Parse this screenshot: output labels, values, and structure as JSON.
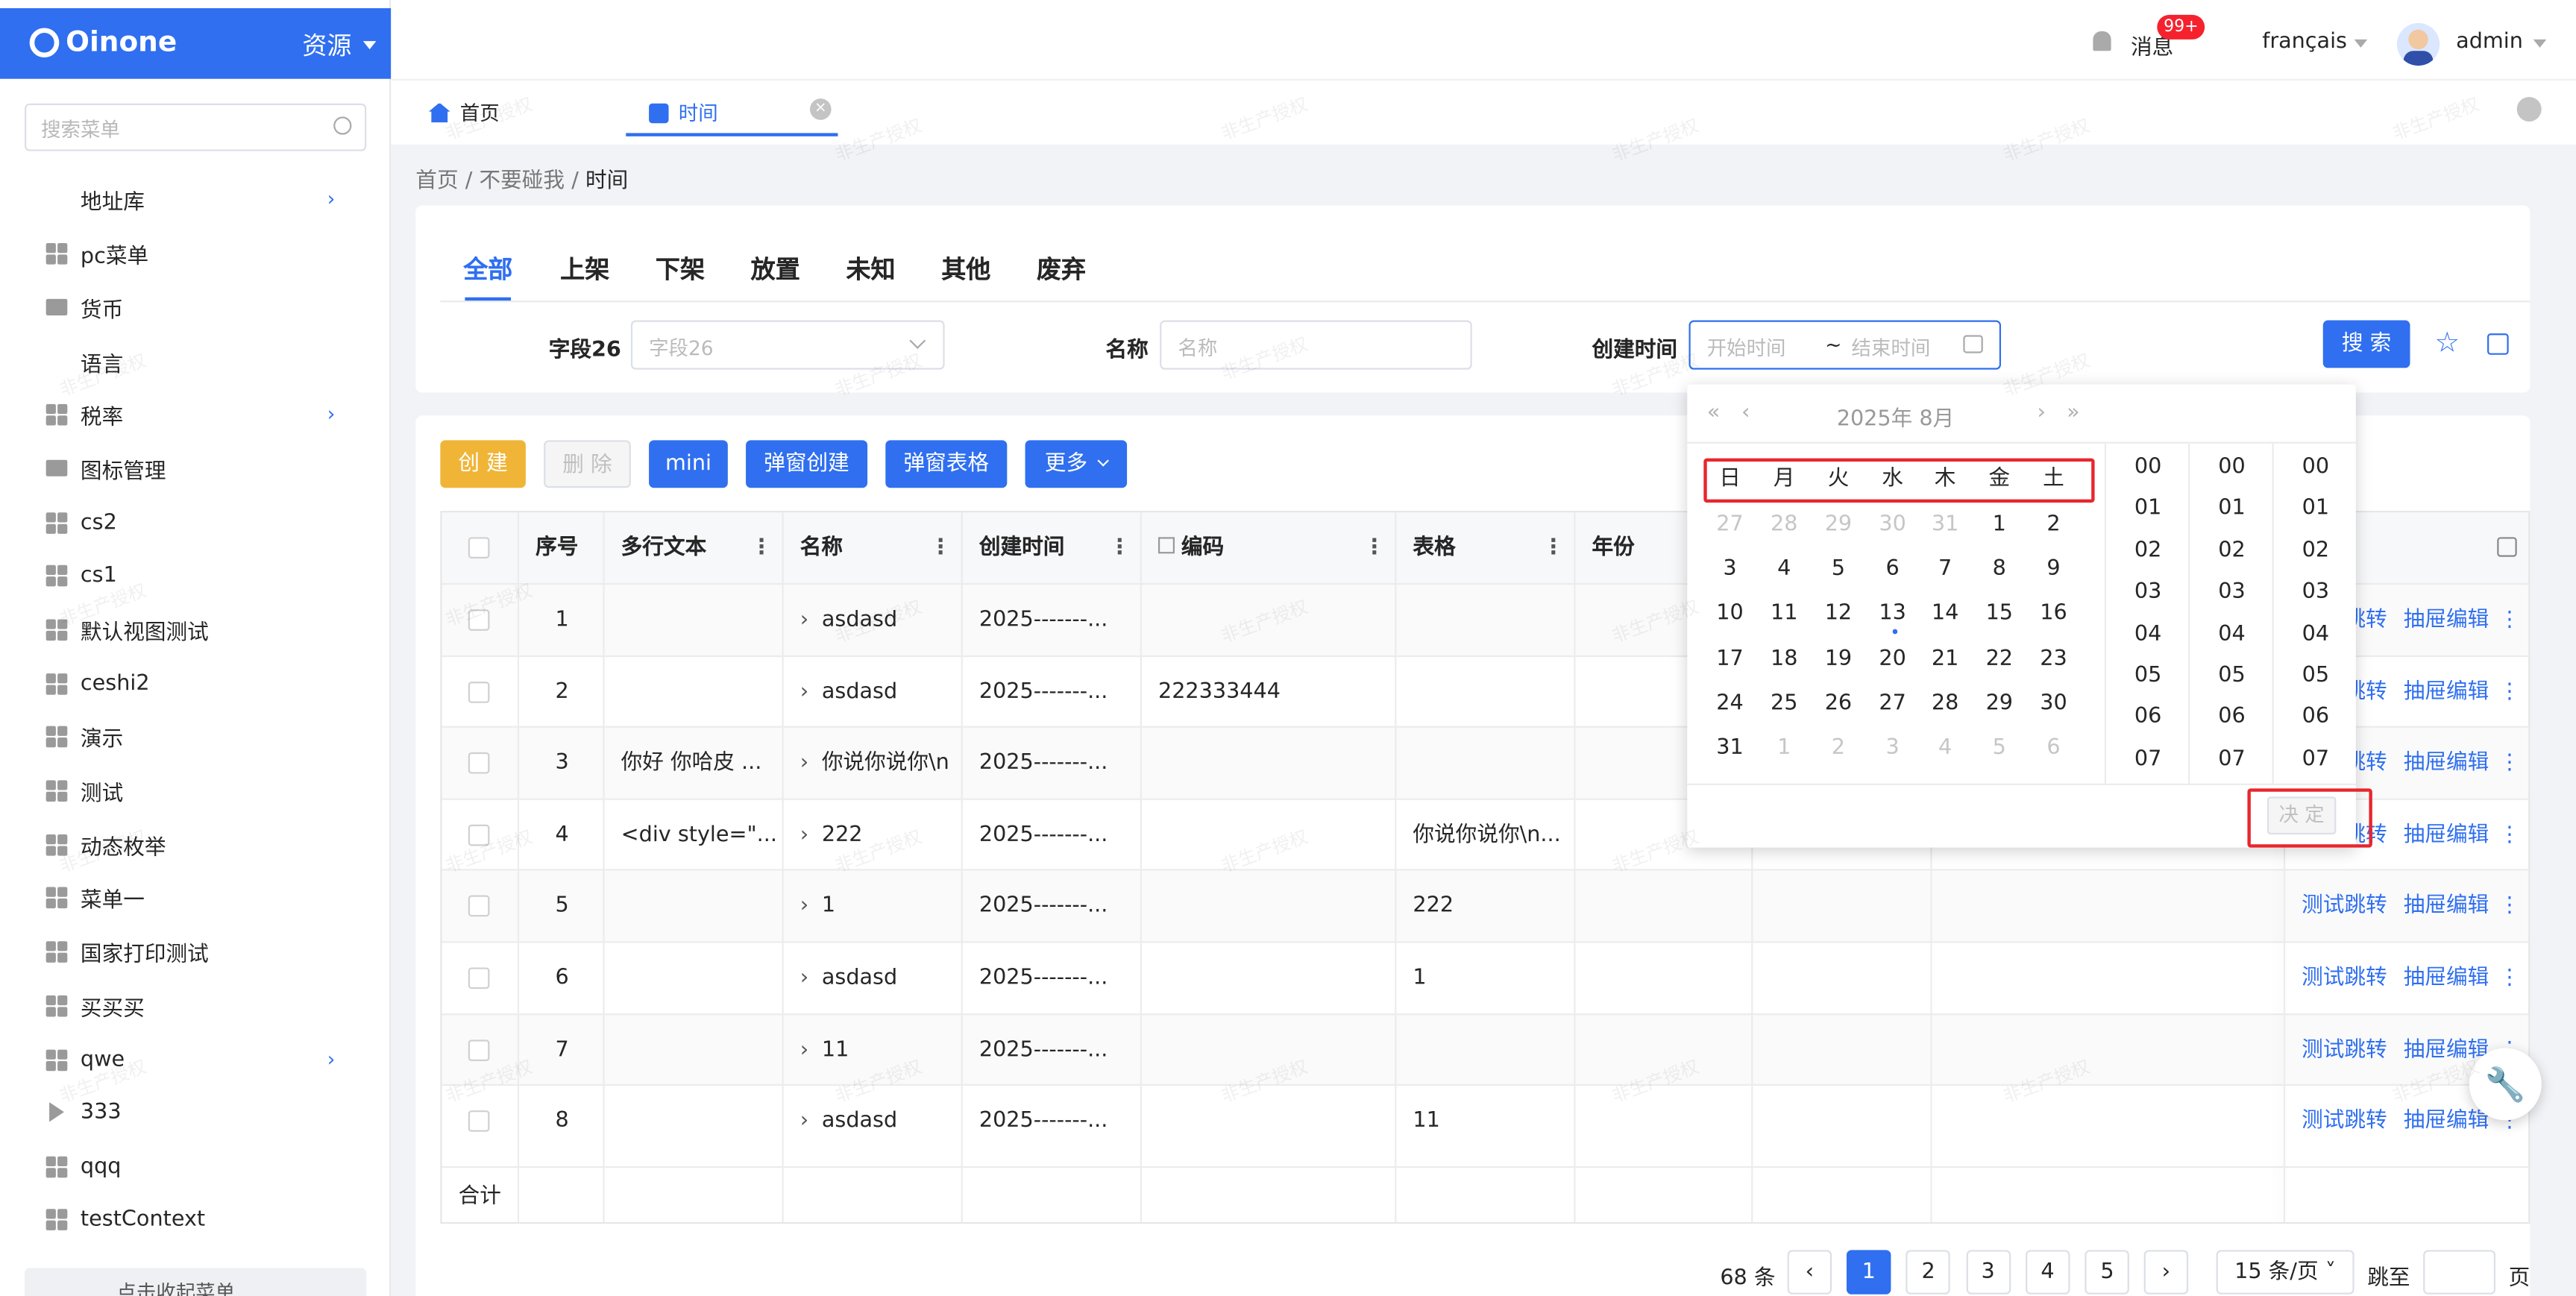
{
  "app": {
    "logo": "Oinone",
    "module": "资源",
    "search_placeholder": "搜索菜单"
  },
  "header": {
    "messages_label": "消息",
    "messages_badge": "99+",
    "language": "français",
    "user": "admin"
  },
  "page_tabs": [
    {
      "label": "首页"
    },
    {
      "label": "时间"
    }
  ],
  "breadcrumb": {
    "home": "首页",
    "parent": "不要碰我",
    "current": "时间"
  },
  "sidebar": {
    "items": [
      {
        "label": "地址库",
        "icon": "none",
        "expand": true
      },
      {
        "label": "pc菜单",
        "icon": "grid-icon"
      },
      {
        "label": "货币",
        "icon": "folder-icon"
      },
      {
        "label": "语言",
        "icon": "none"
      },
      {
        "label": "税率",
        "icon": "grid-icon",
        "expand": true
      },
      {
        "label": "图标管理",
        "icon": "folder-icon"
      },
      {
        "label": "cs2",
        "icon": "grid-icon"
      },
      {
        "label": "cs1",
        "icon": "grid-icon"
      },
      {
        "label": "默认视图测试",
        "icon": "grid-icon"
      },
      {
        "label": "ceshi2",
        "icon": "grid-icon"
      },
      {
        "label": "演示",
        "icon": "grid-icon"
      },
      {
        "label": "测试",
        "icon": "grid-icon"
      },
      {
        "label": "动态枚举",
        "icon": "grid-icon"
      },
      {
        "label": "菜单一",
        "icon": "grid-icon"
      },
      {
        "label": "国家打印测试",
        "icon": "grid-icon"
      },
      {
        "label": "买买买",
        "icon": "grid-icon"
      },
      {
        "label": "qwe",
        "icon": "grid-icon",
        "expand": true
      },
      {
        "label": "333",
        "icon": "triangle-icon"
      },
      {
        "label": "qqq",
        "icon": "grid-icon"
      },
      {
        "label": "testContext",
        "icon": "grid-icon"
      }
    ],
    "collapse_label": "点击收起菜单"
  },
  "filter": {
    "tabs": [
      "全部",
      "上架",
      "下架",
      "放置",
      "未知",
      "其他",
      "废弃"
    ],
    "active_tab": "全部",
    "field26_label": "字段26",
    "field26_placeholder": "字段26",
    "name_label": "名称",
    "name_placeholder": "名称",
    "created_label": "创建时间",
    "start_placeholder": "开始时间",
    "end_placeholder": "结束时间",
    "range_sep": "~",
    "search_label": "搜 索"
  },
  "actions": {
    "create": "创 建",
    "delete": "删 除",
    "mini": "mini",
    "popup_create": "弹窗创建",
    "popup_table": "弹窗表格",
    "more": "更多"
  },
  "table": {
    "columns": [
      "序号",
      "多行文本",
      "名称",
      "创建时间",
      "编码",
      "表格",
      "年份"
    ],
    "rows": [
      {
        "no": "1",
        "text": "",
        "name": "asdasd",
        "created": "2025-------...",
        "code": "",
        "table": ""
      },
      {
        "no": "2",
        "text": "",
        "name": "asdasd",
        "created": "2025-------...",
        "code": "222333444",
        "table": ""
      },
      {
        "no": "3",
        "text": "你好 你哈皮 ...",
        "name": "你说你说你\\n",
        "created": "2025-------...",
        "code": "",
        "table": ""
      },
      {
        "no": "4",
        "text": "<div style=\"...",
        "name": "222",
        "created": "2025-------...",
        "code": "",
        "table": "你说你说你\\n..."
      },
      {
        "no": "5",
        "text": "",
        "name": "1",
        "created": "2025-------...",
        "code": "",
        "table": "222"
      },
      {
        "no": "6",
        "text": "",
        "name": "asdasd",
        "created": "2025-------...",
        "code": "",
        "table": "1"
      },
      {
        "no": "7",
        "text": "",
        "name": "11",
        "created": "2025-------...",
        "code": "",
        "table": ""
      },
      {
        "no": "8",
        "text": "",
        "name": "asdasd",
        "created": "2025-------...",
        "code": "",
        "table": "11"
      }
    ],
    "row_actions": {
      "jump": "测试跳转",
      "drawer": "抽屉编辑"
    },
    "sum_label": "合计"
  },
  "pagination": {
    "total": "68 条",
    "pages": [
      "1",
      "2",
      "3",
      "4",
      "5"
    ],
    "current": "1",
    "page_size": "15 条/页",
    "goto_label": "跳至",
    "page_unit": "页"
  },
  "date_picker": {
    "title": "2025年  8月",
    "weekdays": [
      "日",
      "月",
      "火",
      "水",
      "木",
      "金",
      "土"
    ],
    "weeks": [
      [
        "27",
        "28",
        "29",
        "30",
        "31",
        "1",
        "2"
      ],
      [
        "3",
        "4",
        "5",
        "6",
        "7",
        "8",
        "9"
      ],
      [
        "10",
        "11",
        "12",
        "13",
        "14",
        "15",
        "16"
      ],
      [
        "17",
        "18",
        "19",
        "20",
        "21",
        "22",
        "23"
      ],
      [
        "24",
        "25",
        "26",
        "27",
        "28",
        "29",
        "30"
      ],
      [
        "31",
        "1",
        "2",
        "3",
        "4",
        "5",
        "6"
      ]
    ],
    "hours": [
      "00",
      "01",
      "02",
      "03",
      "04",
      "05",
      "06",
      "07"
    ],
    "minutes": [
      "00",
      "01",
      "02",
      "03",
      "04",
      "05",
      "06",
      "07"
    ],
    "seconds": [
      "00",
      "01",
      "02",
      "03",
      "04",
      "05",
      "06",
      "07"
    ],
    "ok_label": "决 定"
  },
  "watermark": "非生产授权",
  "colors": {
    "primary": "#2f6ff0",
    "create": "#f0b537",
    "highlight": "#e8262d"
  }
}
